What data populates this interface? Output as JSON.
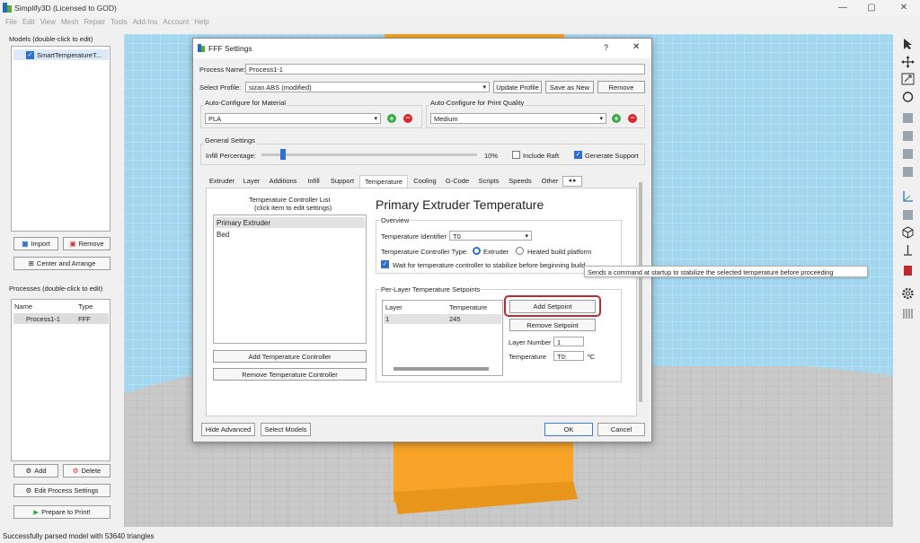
{
  "app": {
    "title": "Simplify3D (Licensed to GOD)",
    "menu": [
      "File",
      "Edit",
      "View",
      "Mesh",
      "Repair",
      "Tools",
      "Add-Ins",
      "Account",
      "Help"
    ],
    "window_controls": {
      "minimize": "—",
      "maximize": "▢",
      "close": "✕"
    }
  },
  "left_panel": {
    "models_header": "Models (double-click to edit)",
    "models": [
      {
        "name": "SmartTemperatureT...",
        "checked": true
      }
    ],
    "import_label": "Import",
    "remove_label": "Remove",
    "center_label": "Center and Arrange",
    "processes_header": "Processes (double-click to edit)",
    "process_columns": [
      "Name",
      "Type"
    ],
    "processes": [
      {
        "name": "Process1-1",
        "type": "FFF"
      }
    ],
    "add_label": "Add",
    "delete_label": "Delete",
    "edit_process_label": "Edit Process Settings",
    "prepare_label": "Prepare to Print!"
  },
  "status_bar": "Successfully parsed model with 53640 triangles",
  "dialog": {
    "title": "FFF Settings",
    "help_glyph": "?",
    "close_glyph": "✕",
    "process_name_label": "Process Name:",
    "process_name_value": "Process1-1",
    "select_profile_label": "Select Profile:",
    "select_profile_value": "sizan ABS  (modified)",
    "update_profile_label": "Update Profile",
    "save_as_new_label": "Save as New",
    "remove_label": "Remove",
    "material_group_label": "Auto-Configure for Material",
    "material_value": "PLA",
    "quality_group_label": "Auto-Configure for Print Quality",
    "quality_value": "Medium",
    "general_group_label": "General Settings",
    "infill_label": "Infill Percentage:",
    "infill_value": "10%",
    "infill_fraction": 0.1,
    "include_raft_label": "Include Raft",
    "include_raft_checked": false,
    "generate_support_label": "Generate Support",
    "generate_support_checked": true,
    "tabs": [
      "Extruder",
      "Layer",
      "Additions",
      "Infill",
      "Support",
      "Temperature",
      "Cooling",
      "G-Code",
      "Scripts",
      "Speeds",
      "Other"
    ],
    "active_tab": "Temperature",
    "controller_list_title_1": "Temperature Controller List",
    "controller_list_title_2": "(click item to edit settings)",
    "controllers": [
      "Primary Extruder",
      "Bed"
    ],
    "selected_controller": "Primary Extruder",
    "add_controller_label": "Add Temperature Controller",
    "remove_controller_label": "Remove Temperature Controller",
    "heading": "Primary Extruder Temperature",
    "overview_label": "Overview",
    "temp_identifier_label": "Temperature Identifier",
    "temp_identifier_value": "T0",
    "controller_type_label": "Temperature Controller Type:",
    "controller_type_options": [
      "Extruder",
      "Heated build platform"
    ],
    "controller_type_selected": "Extruder",
    "wait_label": "Wait for temperature controller to stabilize before beginning build",
    "wait_checked": true,
    "tooltip": "Sends a command at startup to stabilize the selected temperature before proceeding",
    "setpoints_group_label": "Per-Layer Temperature Setpoints",
    "setpoint_columns": [
      "Layer",
      "Temperature"
    ],
    "setpoints": [
      {
        "layer": "1",
        "temperature": "245"
      }
    ],
    "add_setpoint_label": "Add Setpoint",
    "remove_setpoint_label": "Remove Setpoint",
    "layer_number_label": "Layer Number",
    "layer_number_value": "1",
    "temperature_label": "Temperature",
    "temperature_value": "T0:",
    "temperature_unit": "ºC",
    "hide_advanced_label": "Hide Advanced",
    "select_models_label": "Select Models",
    "ok_label": "OK",
    "cancel_label": "Cancel"
  },
  "colors": {
    "accent": "#2f6fd0",
    "highlight_ring": "#c0282c",
    "grid_bg": "#a3d7ef",
    "model": "#f7a428",
    "floor": "#c9c9c9"
  }
}
